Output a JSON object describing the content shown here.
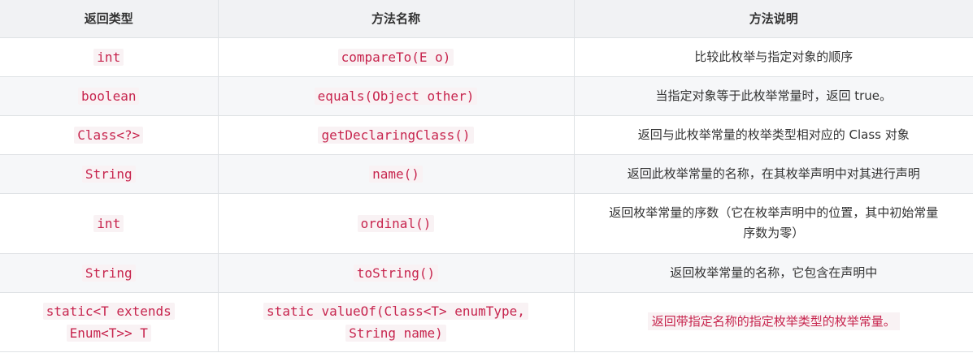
{
  "table": {
    "headers": [
      "返回类型",
      "方法名称",
      "方法说明"
    ],
    "rows": [
      {
        "type_lines": [
          "int"
        ],
        "name_lines": [
          "compareTo(E o)"
        ],
        "desc": "比较此枚举与指定对象的顺序"
      },
      {
        "type_lines": [
          "boolean"
        ],
        "name_lines": [
          "equals(Object other)"
        ],
        "desc": "当指定对象等于此枚举常量时，返回 true。"
      },
      {
        "type_lines": [
          "Class<?>"
        ],
        "name_lines": [
          "getDeclaringClass()"
        ],
        "desc": "返回与此枚举常量的枚举类型相对应的 Class 对象"
      },
      {
        "type_lines": [
          "String"
        ],
        "name_lines": [
          "name()"
        ],
        "desc": "返回此枚举常量的名称，在其枚举声明中对其进行声明"
      },
      {
        "type_lines": [
          "int"
        ],
        "name_lines": [
          "ordinal()"
        ],
        "desc_lines": [
          "返回枚举常量的序数（它在枚举声明中的位置，其中初始常量",
          "序数为零）"
        ]
      },
      {
        "type_lines": [
          "String"
        ],
        "name_lines": [
          "toString()"
        ],
        "desc": "返回枚举常量的名称，它包含在声明中"
      },
      {
        "type_lines": [
          "static<T extends",
          "Enum<T>> T"
        ],
        "name_lines": [
          "static valueOf(Class<T> enumType,",
          "String name)"
        ],
        "desc": "返回带指定名称的指定枚举类型的枚举常量。"
      }
    ]
  }
}
